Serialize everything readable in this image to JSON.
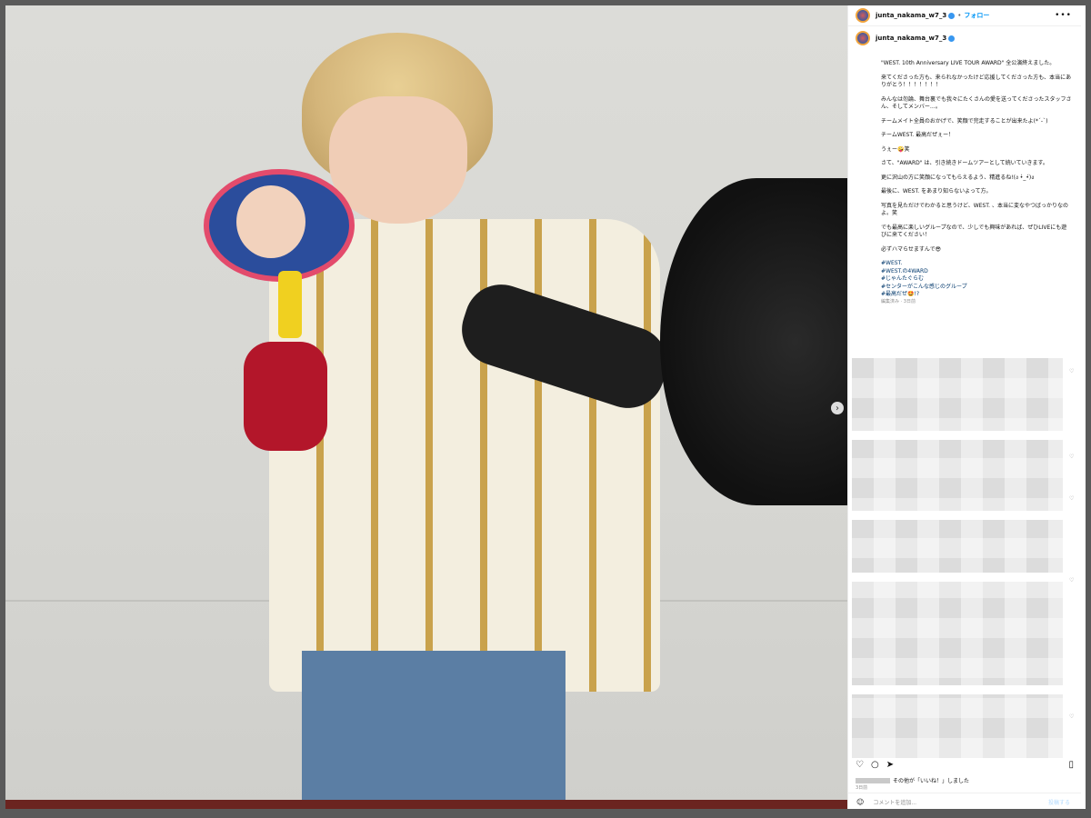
{
  "header": {
    "username": "junta_nakama_w7_3",
    "separator": "•",
    "follow_label": "フォロー",
    "more_label": "•••"
  },
  "caption": {
    "username": "junta_nakama_w7_3",
    "paragraphs": [
      "\"WEST. 10th Anniversary LIVE TOUR AWARD\" 全公演終えました。",
      "来てくださった方も、来られなかったけど応援してくださった方も、本当にありがとう！！！！！！！",
      "みんなは勿論、舞台裏でも我々にたくさんの愛を送ってくださったスタッフさん、そしてメンバー…。",
      "チームメイト全員のおかげで、笑顔で完走することが出来たよ(*´-`)",
      "チームWEST. 最高だぜぇー！",
      "うぇー🤪笑",
      "さて、\"AWARD\" は、引き続きドームツアーとして続いていきます。",
      "更に沢山の方に笑顔になってもらえるよう、精進るね!(ง •̀_•́)ง",
      "最後に、WEST. をあまり知らないよって方。",
      "写真を見ただけでわかると思うけど、WEST. 、本当に変なやつばっかりなのよ。笑",
      "でも最高に楽しいグループなので、少しでも興味があれば、ぜひLIVEにも遊びに来てください！",
      "必ずハマらせますんで😎"
    ],
    "tags": [
      "#WEST.",
      "#WEST.の4WARD",
      "#じゃんたぐらむ",
      "#センターがこんな感じのグループ",
      "#最高だぜ🤩!?"
    ],
    "edited": "編集済み · 3日前"
  },
  "footer": {
    "likes_text": "その他が「いいね！」しました",
    "time": "3日前",
    "comment_placeholder": "コメントを追加...",
    "post_label": "投稿する"
  },
  "icons": {
    "like": "heart-icon",
    "comment": "comment-icon",
    "share": "share-icon",
    "save": "bookmark-icon",
    "emoji": "emoji-icon",
    "next": "chevron-right-icon"
  },
  "colors": {
    "link": "#0095f6",
    "tag": "#00376b",
    "verified": "#3897f0"
  }
}
